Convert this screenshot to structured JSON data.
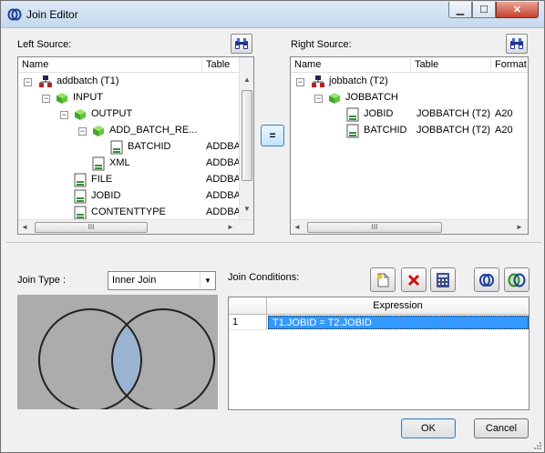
{
  "window": {
    "title": "Join Editor"
  },
  "left_source": {
    "label": "Left Source:",
    "headers": [
      "Name",
      "Table"
    ],
    "rows": [
      {
        "name": "addbatch (T1)",
        "table": "",
        "icon": "source-table-icon"
      },
      {
        "name": "INPUT",
        "table": "",
        "icon": "element-group-icon"
      },
      {
        "name": "OUTPUT",
        "table": "",
        "icon": "element-group-icon"
      },
      {
        "name": "ADD_BATCH_RE...",
        "table": "",
        "icon": "element-group-icon"
      },
      {
        "name": "BATCHID",
        "table": "ADDBA",
        "icon": "field-icon"
      },
      {
        "name": "XML",
        "table": "ADDBA",
        "icon": "field-icon"
      },
      {
        "name": "FILE",
        "table": "ADDBA",
        "icon": "field-icon"
      },
      {
        "name": "JOBID",
        "table": "ADDBA",
        "icon": "field-icon"
      },
      {
        "name": "CONTENTTYPE",
        "table": "ADDBA",
        "icon": "field-icon"
      }
    ]
  },
  "right_source": {
    "label": "Right Source:",
    "headers": [
      "Name",
      "Table",
      "Format"
    ],
    "rows": [
      {
        "name": "jobbatch (T2)",
        "table": "",
        "format": "",
        "icon": "source-table-icon"
      },
      {
        "name": "JOBBATCH",
        "table": "",
        "format": "",
        "icon": "element-group-icon"
      },
      {
        "name": "JOBID",
        "table": "JOBBATCH (T2)",
        "format": "A20",
        "icon": "field-icon"
      },
      {
        "name": "BATCHID",
        "table": "JOBBATCH (T2)",
        "format": "A20",
        "icon": "field-icon"
      }
    ]
  },
  "equals_button": "=",
  "join_type": {
    "label": "Join Type :",
    "value": "Inner Join"
  },
  "join_conditions": {
    "label": "Join Conditions:",
    "column_header": "Expression",
    "rows": [
      {
        "num": "1",
        "expression": "T1.JOBID = T2.JOBID"
      }
    ]
  },
  "buttons": {
    "ok": "OK",
    "cancel": "Cancel"
  },
  "scroll_glyph": "III",
  "colors": {
    "selection": "#3399ff",
    "venn_background": "#acacac",
    "venn_overlap": "#9ab4d2"
  }
}
